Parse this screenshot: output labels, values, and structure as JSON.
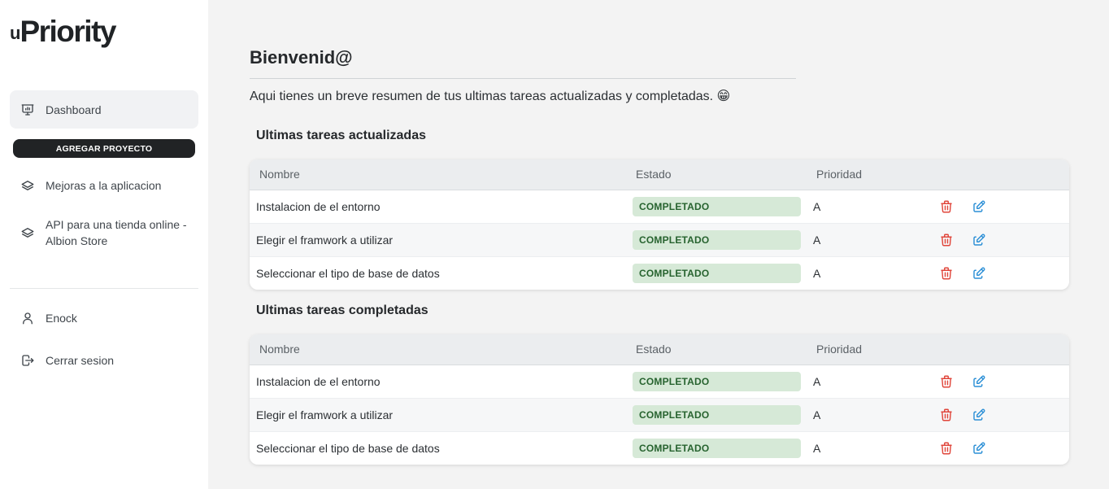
{
  "app": {
    "logo_prefix": "u",
    "logo_text": "Priority"
  },
  "sidebar": {
    "dashboard_label": "Dashboard",
    "add_project_label": "AGREGAR PROYECTO",
    "projects": [
      {
        "label": "Mejoras a la aplicacion",
        "icon": "layers-icon"
      },
      {
        "label": "API para una tienda online - Albion Store",
        "icon": "layers-icon"
      }
    ],
    "user_label": "Enock",
    "logout_label": "Cerrar sesion"
  },
  "main": {
    "title": "Bienvenid@",
    "subtitle": "Aqui tienes un breve resumen de tus ultimas tareas actualizadas y completadas. 😁",
    "columns": {
      "name": "Nombre",
      "state": "Estado",
      "priority": "Prioridad"
    },
    "updated": {
      "heading": "Ultimas tareas actualizadas",
      "rows": [
        {
          "name": "Instalacion de el entorno",
          "state": "COMPLETADO",
          "priority": "A"
        },
        {
          "name": "Elegir el framwork a utilizar",
          "state": "COMPLETADO",
          "priority": "A"
        },
        {
          "name": "Seleccionar el tipo de base de datos",
          "state": "COMPLETADO",
          "priority": "A"
        }
      ]
    },
    "completed": {
      "heading": "Ultimas tareas completadas",
      "rows": [
        {
          "name": "Instalacion de el entorno",
          "state": "COMPLETADO",
          "priority": "A"
        },
        {
          "name": "Elegir el framwork a utilizar",
          "state": "COMPLETADO",
          "priority": "A"
        },
        {
          "name": "Seleccionar el tipo de base de datos",
          "state": "COMPLETADO",
          "priority": "A"
        }
      ]
    }
  },
  "colors": {
    "badge_bg": "#d6e9d7",
    "badge_text": "#27632f",
    "delete_icon": "#e0453a",
    "edit_icon": "#2b8fd6"
  }
}
